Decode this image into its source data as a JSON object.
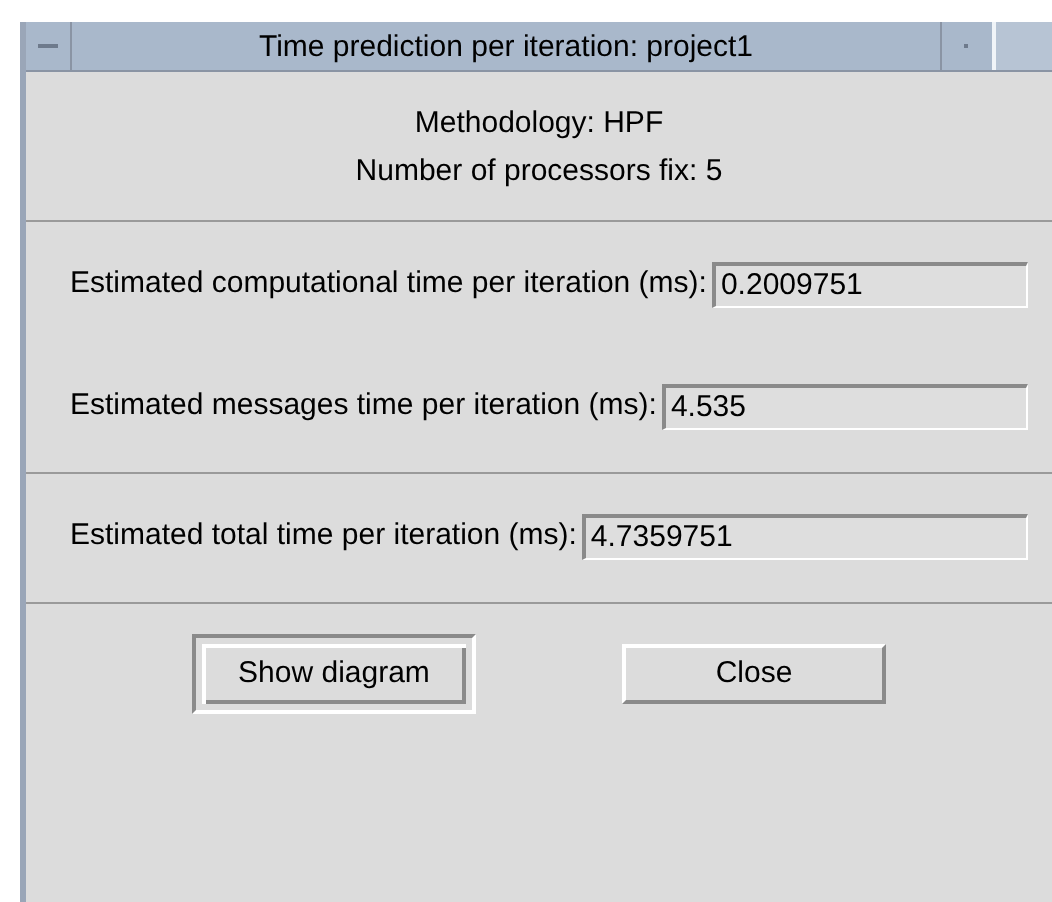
{
  "window": {
    "title": "Time prediction per iteration: project1"
  },
  "header": [
    "Methodology: HPF",
    "Number of processors fix: 5"
  ],
  "sections": [
    [
      {
        "label": "Estimated computational time per iteration (ms):",
        "value": "0.2009751"
      },
      {
        "label": "Estimated messages time per iteration (ms):",
        "value": "4.535"
      }
    ],
    [
      {
        "label": "Estimated total time per iteration (ms):",
        "value": "4.7359751"
      }
    ]
  ],
  "buttons": [
    {
      "label": "Show diagram",
      "default": true
    },
    {
      "label": "Close",
      "default": false
    }
  ]
}
